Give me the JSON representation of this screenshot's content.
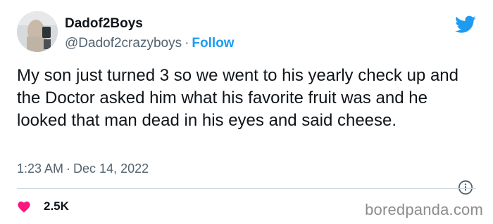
{
  "tweet": {
    "display_name": "Dadof2Boys",
    "handle": "@Dadof2crazyboys",
    "separator": "·",
    "follow_label": "Follow",
    "text": "My son just turned 3 so we went to his yearly check up and the Doctor asked him what his favorite fruit was and he looked that man dead in his eyes and said cheese.",
    "time": "1:23 AM",
    "date": "Dec 14, 2022",
    "like_count": "2.5K"
  },
  "icons": {
    "logo": "twitter-bird-icon",
    "info": "info-icon",
    "like": "heart-icon"
  },
  "colors": {
    "accent": "#1d9bf0",
    "like": "#f91880",
    "secondary_text": "#536471"
  },
  "watermark": "boredpanda.com"
}
